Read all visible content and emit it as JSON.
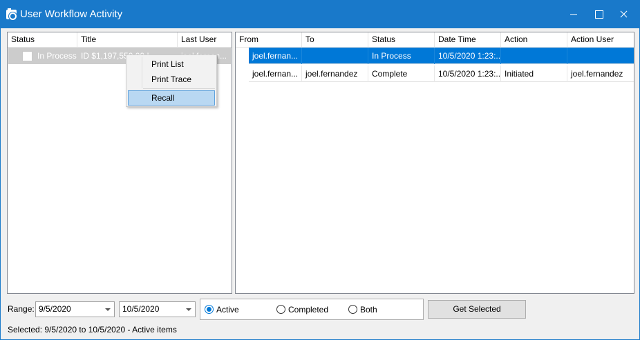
{
  "window": {
    "title": "User Workflow Activity"
  },
  "left_list": {
    "columns": [
      "Status",
      "Title",
      "Last User"
    ],
    "rows": [
      {
        "status": "In Process",
        "title": "ID $1,197,550.00 I...",
        "last_user": "joel.fernan..."
      }
    ]
  },
  "context_menu": {
    "items": [
      "Print List",
      "Print Trace",
      "Recall"
    ],
    "highlighted": "Recall"
  },
  "right_list": {
    "columns": [
      "From",
      "To",
      "Status",
      "Date Time",
      "Action",
      "Action User"
    ],
    "rows": [
      {
        "from": "joel.fernan...",
        "to": "",
        "status": "In Process",
        "date_time": "10/5/2020 1:23:...",
        "action": "",
        "action_user": "",
        "selected": true
      },
      {
        "from": "joel.fernan...",
        "to": "joel.fernandez",
        "status": "Complete",
        "date_time": "10/5/2020 1:23:...",
        "action": "Initiated",
        "action_user": "joel.fernandez",
        "selected": false
      }
    ]
  },
  "footer": {
    "range_label": "Range:",
    "from_date": "9/5/2020",
    "to_date": "10/5/2020",
    "radio": {
      "active": "Active",
      "completed": "Completed",
      "both": "Both",
      "selected": "Active"
    },
    "get_selected_label": "Get Selected",
    "status_text": "Selected: 9/5/2020 to 10/5/2020 - Active items"
  },
  "colors": {
    "title_bar": "#1979ca",
    "selection": "#0078d7",
    "menu_highlight": "#b9d8f2"
  }
}
